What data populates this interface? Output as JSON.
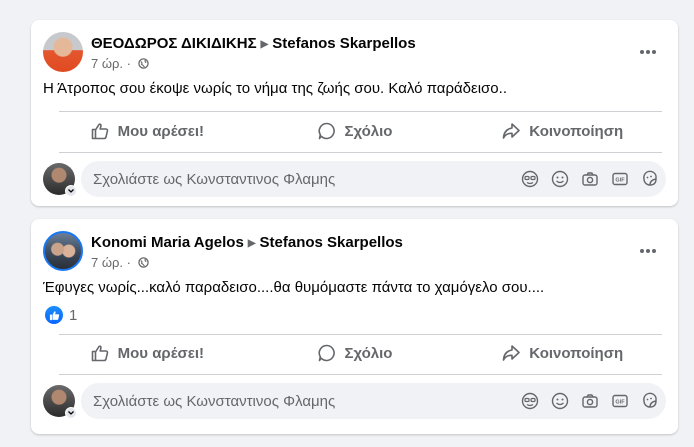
{
  "comment_placeholder": "Σχολιάστε ως Κωνσταντινος Φλαμης",
  "actions": {
    "like": "Μου αρέσει!",
    "comment": "Σχόλιο",
    "share": "Κοινοποίηση"
  },
  "posts": [
    {
      "author": "ΘΕΟΔΩΡΟΣ ΔΙΚΙΔΙΚΗΣ",
      "target": "Stefanos Skarpellos",
      "time": "7 ώρ. ·",
      "text": "Η Άτροπος σου έκοψε νωρίς το νήμα της ζωής σου. Καλό παράδεισο..",
      "reaction_count": ""
    },
    {
      "author": "Konomi Maria Agelos",
      "target": "Stefanos Skarpellos",
      "time": "7 ώρ. ·",
      "text": "Έφυγες νωρίς...καλό παραδεισο....θα θυμόμαστε πάντα το χαμόγελο σου....",
      "reaction_count": "1"
    }
  ],
  "colors": {
    "background": "#f0f2f5",
    "card": "#ffffff",
    "secondary_text": "#65676b",
    "accent": "#1877f2"
  },
  "icons": [
    "globe-icon",
    "more-icon",
    "like-icon",
    "comment-icon",
    "share-icon",
    "sticker-icon",
    "emoji-icon",
    "camera-icon",
    "gif-icon",
    "avatar-sticker-icon"
  ]
}
